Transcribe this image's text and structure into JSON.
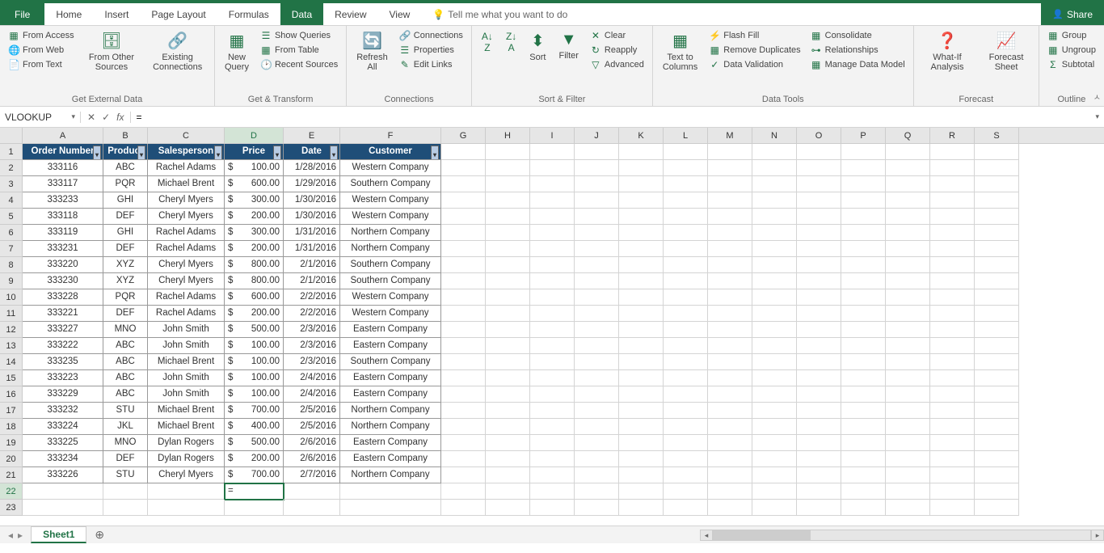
{
  "tabs": {
    "file": "File",
    "home": "Home",
    "insert": "Insert",
    "pageLayout": "Page Layout",
    "formulas": "Formulas",
    "data": "Data",
    "review": "Review",
    "view": "View",
    "tellMe": "Tell me what you want to do",
    "share": "Share"
  },
  "ribbon": {
    "getExternal": {
      "title": "Get External Data",
      "fromAccess": "From Access",
      "fromWeb": "From Web",
      "fromText": "From Text",
      "fromOther": "From Other Sources",
      "existing": "Existing Connections"
    },
    "getTransform": {
      "title": "Get & Transform",
      "newQuery": "New Query",
      "showQueries": "Show Queries",
      "fromTable": "From Table",
      "recentSources": "Recent Sources"
    },
    "connections": {
      "title": "Connections",
      "refresh": "Refresh All",
      "connections": "Connections",
      "properties": "Properties",
      "editLinks": "Edit Links"
    },
    "sortFilter": {
      "title": "Sort & Filter",
      "sort": "Sort",
      "filter": "Filter",
      "clear": "Clear",
      "reapply": "Reapply",
      "advanced": "Advanced"
    },
    "dataTools": {
      "title": "Data Tools",
      "textToColumns": "Text to Columns",
      "flashFill": "Flash Fill",
      "removeDup": "Remove Duplicates",
      "dataValidation": "Data Validation",
      "consolidate": "Consolidate",
      "relationships": "Relationships",
      "manageModel": "Manage Data Model"
    },
    "forecast": {
      "title": "Forecast",
      "whatIf": "What-If Analysis",
      "forecastSheet": "Forecast Sheet"
    },
    "outline": {
      "title": "Outline",
      "group": "Group",
      "ungroup": "Ungroup",
      "subtotal": "Subtotal"
    }
  },
  "nameBox": "VLOOKUP",
  "formula": "=",
  "activeCell": "D22",
  "columns": [
    "A",
    "B",
    "C",
    "D",
    "E",
    "F",
    "G",
    "H",
    "I",
    "J",
    "K",
    "L",
    "M",
    "N",
    "O",
    "P",
    "Q",
    "R",
    "S"
  ],
  "headers": [
    "Order Number",
    "Product",
    "Salesperson",
    "Price",
    "Date",
    "Customer"
  ],
  "rows": [
    {
      "r": 2,
      "order": "333116",
      "prod": "ABC",
      "sales": "Rachel Adams",
      "price": "100.00",
      "date": "1/28/2016",
      "cust": "Western Company"
    },
    {
      "r": 3,
      "order": "333117",
      "prod": "PQR",
      "sales": "Michael Brent",
      "price": "600.00",
      "date": "1/29/2016",
      "cust": "Southern Company"
    },
    {
      "r": 4,
      "order": "333233",
      "prod": "GHI",
      "sales": "Cheryl Myers",
      "price": "300.00",
      "date": "1/30/2016",
      "cust": "Western Company"
    },
    {
      "r": 5,
      "order": "333118",
      "prod": "DEF",
      "sales": "Cheryl Myers",
      "price": "200.00",
      "date": "1/30/2016",
      "cust": "Western Company"
    },
    {
      "r": 6,
      "order": "333119",
      "prod": "GHI",
      "sales": "Rachel Adams",
      "price": "300.00",
      "date": "1/31/2016",
      "cust": "Northern Company"
    },
    {
      "r": 7,
      "order": "333231",
      "prod": "DEF",
      "sales": "Rachel Adams",
      "price": "200.00",
      "date": "1/31/2016",
      "cust": "Northern Company"
    },
    {
      "r": 8,
      "order": "333220",
      "prod": "XYZ",
      "sales": "Cheryl Myers",
      "price": "800.00",
      "date": "2/1/2016",
      "cust": "Southern Company"
    },
    {
      "r": 9,
      "order": "333230",
      "prod": "XYZ",
      "sales": "Cheryl Myers",
      "price": "800.00",
      "date": "2/1/2016",
      "cust": "Southern Company"
    },
    {
      "r": 10,
      "order": "333228",
      "prod": "PQR",
      "sales": "Rachel Adams",
      "price": "600.00",
      "date": "2/2/2016",
      "cust": "Western Company"
    },
    {
      "r": 11,
      "order": "333221",
      "prod": "DEF",
      "sales": "Rachel Adams",
      "price": "200.00",
      "date": "2/2/2016",
      "cust": "Western Company"
    },
    {
      "r": 12,
      "order": "333227",
      "prod": "MNO",
      "sales": "John Smith",
      "price": "500.00",
      "date": "2/3/2016",
      "cust": "Eastern Company"
    },
    {
      "r": 13,
      "order": "333222",
      "prod": "ABC",
      "sales": "John Smith",
      "price": "100.00",
      "date": "2/3/2016",
      "cust": "Eastern Company"
    },
    {
      "r": 14,
      "order": "333235",
      "prod": "ABC",
      "sales": "Michael Brent",
      "price": "100.00",
      "date": "2/3/2016",
      "cust": "Southern Company"
    },
    {
      "r": 15,
      "order": "333223",
      "prod": "ABC",
      "sales": "John Smith",
      "price": "100.00",
      "date": "2/4/2016",
      "cust": "Eastern Company"
    },
    {
      "r": 16,
      "order": "333229",
      "prod": "ABC",
      "sales": "John Smith",
      "price": "100.00",
      "date": "2/4/2016",
      "cust": "Eastern Company"
    },
    {
      "r": 17,
      "order": "333232",
      "prod": "STU",
      "sales": "Michael Brent",
      "price": "700.00",
      "date": "2/5/2016",
      "cust": "Northern Company"
    },
    {
      "r": 18,
      "order": "333224",
      "prod": "JKL",
      "sales": "Michael Brent",
      "price": "400.00",
      "date": "2/5/2016",
      "cust": "Northern Company"
    },
    {
      "r": 19,
      "order": "333225",
      "prod": "MNO",
      "sales": "Dylan Rogers",
      "price": "500.00",
      "date": "2/6/2016",
      "cust": "Eastern Company"
    },
    {
      "r": 20,
      "order": "333234",
      "prod": "DEF",
      "sales": "Dylan Rogers",
      "price": "200.00",
      "date": "2/6/2016",
      "cust": "Eastern Company"
    },
    {
      "r": 21,
      "order": "333226",
      "prod": "STU",
      "sales": "Cheryl Myers",
      "price": "700.00",
      "date": "2/7/2016",
      "cust": "Northern Company"
    }
  ],
  "sheet": "Sheet1"
}
